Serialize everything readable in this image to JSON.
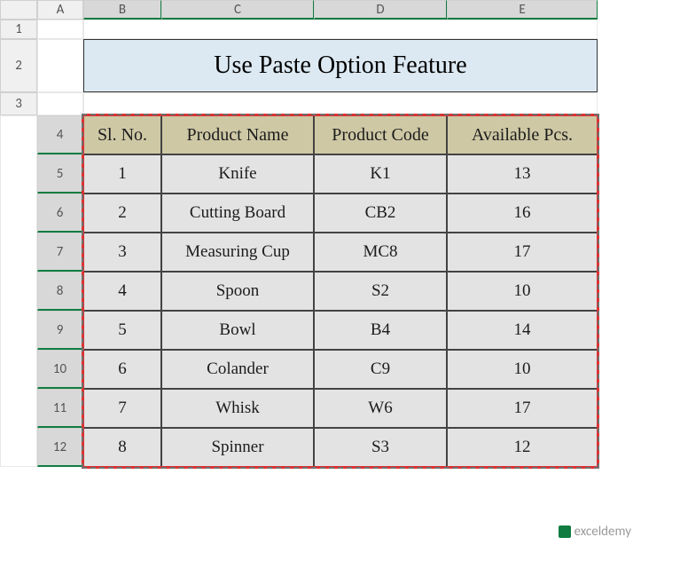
{
  "columns": [
    "A",
    "B",
    "C",
    "D",
    "E"
  ],
  "rows": [
    "1",
    "2",
    "3",
    "4",
    "5",
    "6",
    "7",
    "8",
    "9",
    "10",
    "11",
    "12"
  ],
  "title": "Use Paste Option Feature",
  "headers": {
    "sl": "Sl. No.",
    "name": "Product Name",
    "code": "Product Code",
    "pcs": "Available Pcs."
  },
  "chart_data": {
    "type": "table",
    "columns": [
      "Sl. No.",
      "Product Name",
      "Product Code",
      "Available Pcs."
    ],
    "rows": [
      {
        "sl": "1",
        "name": "Knife",
        "code": "K1",
        "pcs": "13"
      },
      {
        "sl": "2",
        "name": "Cutting Board",
        "code": "CB2",
        "pcs": "16"
      },
      {
        "sl": "3",
        "name": "Measuring Cup",
        "code": "MC8",
        "pcs": "17"
      },
      {
        "sl": "4",
        "name": "Spoon",
        "code": "S2",
        "pcs": "10"
      },
      {
        "sl": "5",
        "name": "Bowl",
        "code": "B4",
        "pcs": "14"
      },
      {
        "sl": "6",
        "name": "Colander",
        "code": "C9",
        "pcs": "10"
      },
      {
        "sl": "7",
        "name": "Whisk",
        "code": "W6",
        "pcs": "17"
      },
      {
        "sl": "8",
        "name": "Spinner",
        "code": "S3",
        "pcs": "12"
      }
    ]
  },
  "watermark": "exceldemy"
}
